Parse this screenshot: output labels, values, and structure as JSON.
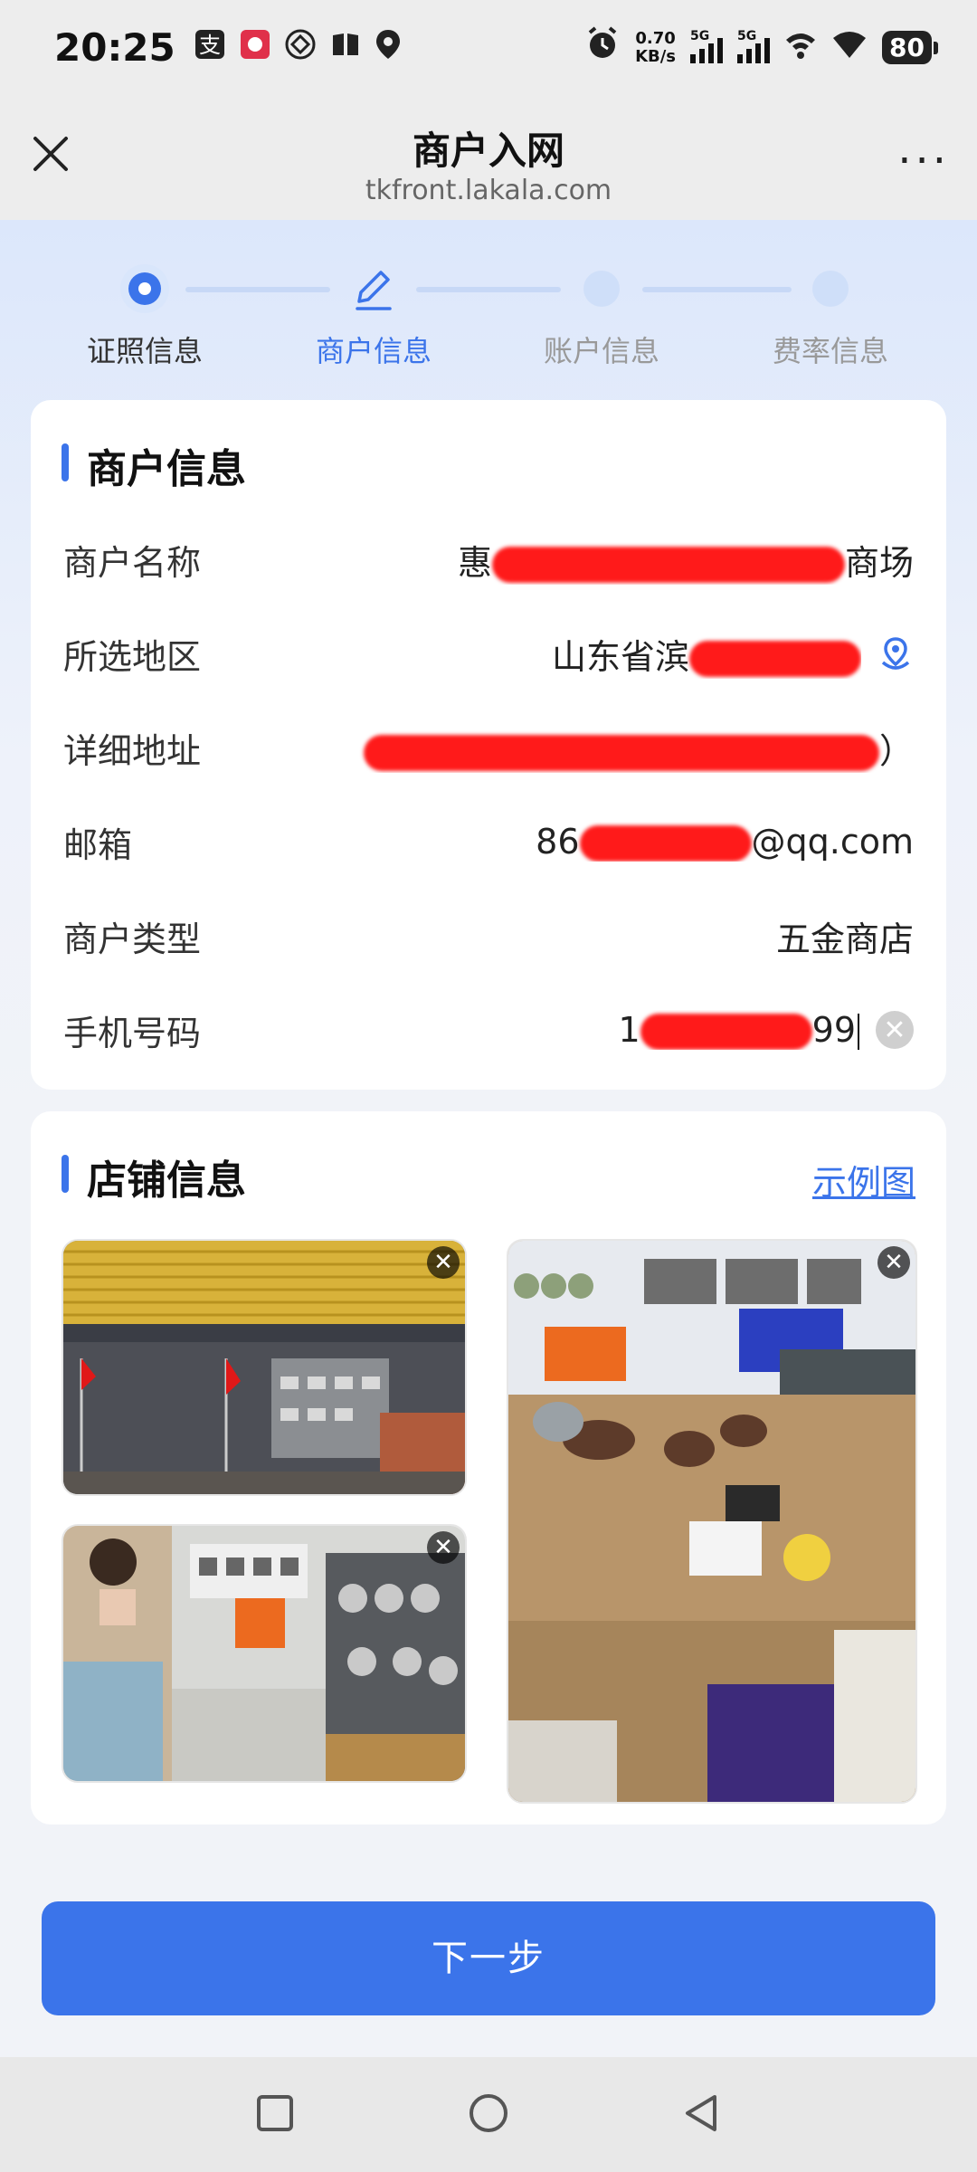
{
  "status_bar": {
    "time": "20:25",
    "left_icons": [
      "alipay-icon",
      "notification-icon",
      "mobile-icon",
      "book-icon",
      "map-pin-icon"
    ],
    "net_speed_value": "0.70",
    "net_speed_unit": "KB/s",
    "signal1_tag": "5G",
    "signal2_tag": "5G",
    "battery": "80"
  },
  "nav": {
    "title": "商户入网",
    "url": "tkfront.lakala.com",
    "more": "···"
  },
  "steps": [
    {
      "label": "证照信息",
      "state": "done"
    },
    {
      "label": "商户信息",
      "state": "active"
    },
    {
      "label": "账户信息",
      "state": "pending"
    },
    {
      "label": "费率信息",
      "state": "pending"
    }
  ],
  "merchant_card": {
    "title": "商户信息",
    "rows": [
      {
        "label": "商户名称",
        "value_prefix": "惠",
        "value_suffix": "商场"
      },
      {
        "label": "所选地区",
        "value_prefix": "山东省滨",
        "value_suffix": ""
      },
      {
        "label": "详细地址",
        "value_prefix": "",
        "value_suffix": "）"
      },
      {
        "label": "邮箱",
        "value_prefix": "86",
        "value_suffix": "@qq.com"
      },
      {
        "label": "商户类型",
        "value": "五金商店"
      },
      {
        "label": "手机号码",
        "value_prefix": "1",
        "value_suffix": "99"
      }
    ]
  },
  "store_card": {
    "title": "店铺信息",
    "example_link": "示例图"
  },
  "next_button": "下一步",
  "colors": {
    "accent": "#3b74ea",
    "redaction": "#ff1a1a",
    "background": "#f1f3f8"
  }
}
